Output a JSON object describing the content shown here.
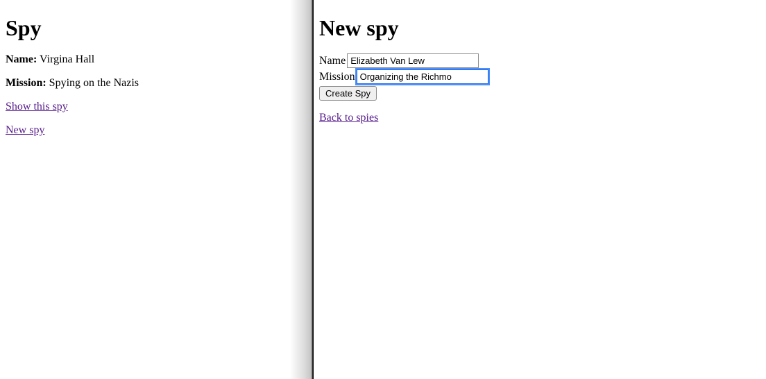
{
  "left": {
    "title": "Spy",
    "name_label": "Name:",
    "name_value": "Virgina Hall",
    "mission_label": "Mission:",
    "mission_value": "Spying on the Nazis",
    "show_link": "Show this spy",
    "new_link": "New spy"
  },
  "right": {
    "title": "New spy",
    "name_label": "Name",
    "name_value": "Elizabeth Van Lew",
    "mission_label": "Mission",
    "mission_value": "Organizing the Richmo",
    "submit_label": "Create Spy",
    "back_link": "Back to spies"
  }
}
